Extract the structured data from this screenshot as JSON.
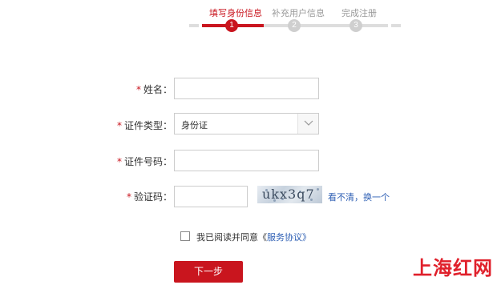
{
  "steps": [
    {
      "label": "填写身份信息",
      "number": "1",
      "active": true
    },
    {
      "label": "补充用户信息",
      "number": "2",
      "active": false
    },
    {
      "label": "完成注册",
      "number": "3",
      "active": false
    }
  ],
  "form": {
    "required_mark": "*",
    "name_label": "姓名：",
    "name_value": "",
    "id_type_label": "证件类型：",
    "id_type_value": "身份证",
    "id_number_label": "证件号码：",
    "id_number_value": "",
    "captcha_label": "验证码：",
    "captcha_value": "",
    "captcha_text": "ukx3q7",
    "refresh_link": "看不清，换一个"
  },
  "agreement": {
    "text": "我已阅读并同意《",
    "link": "服务协议》",
    "checked": false
  },
  "next_button": "下一步",
  "watermark": "上海红网",
  "colors": {
    "accent": "#c9151e",
    "link": "#2e5fb4"
  }
}
